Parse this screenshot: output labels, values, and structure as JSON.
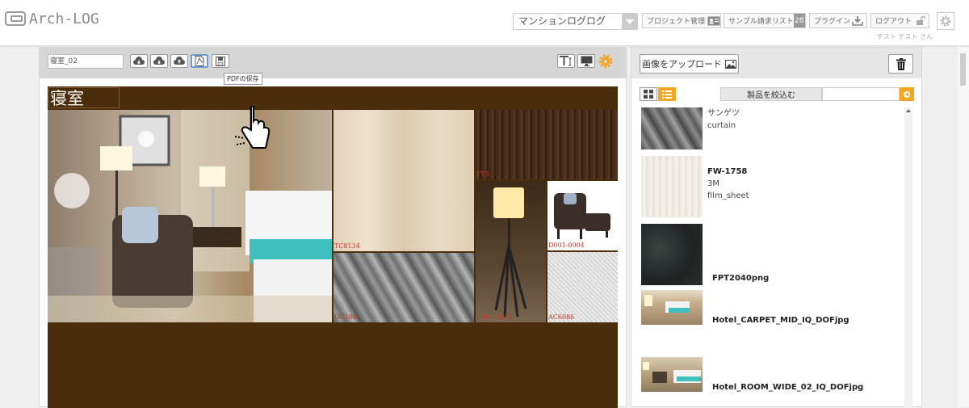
{
  "app": {
    "logo_text": "Arch-LOG"
  },
  "header": {
    "project_select": {
      "value": "マンションログログ"
    },
    "buttons": {
      "project_manage": "プロジェクト管理",
      "sample_list": "サンプル請求リスト",
      "sample_count": "28",
      "plugin": "プラグイン",
      "logout": "ログアウト"
    },
    "user_name": "テスト テスト さん"
  },
  "editor": {
    "board_name": "寝室_02",
    "tooltip": "PDFの保存",
    "board_title": "寝室",
    "tiles": [
      {
        "label": "TC8134"
      },
      {
        "label": "FT3"
      },
      {
        "label": "D001-0004"
      },
      {
        "label": "DC588"
      },
      {
        "label": "D001-0022"
      },
      {
        "label": "AC6086"
      }
    ]
  },
  "panel": {
    "upload_label": "画像をアップロード",
    "filter_label": "製品を絞込む",
    "filter_value": "",
    "items": [
      {
        "lines": [
          "サンゲツ",
          "curtain"
        ],
        "title": ""
      },
      {
        "title": "FW-1758",
        "lines": [
          "3M",
          "film_sheet"
        ]
      },
      {
        "title": "FPT2040png",
        "lines": []
      },
      {
        "title": "Hotel_CARPET_MID_IQ_DOFjpg",
        "lines": []
      },
      {
        "title": "Hotel_ROOM_WIDE_02_IQ_DOFjpg",
        "lines": []
      }
    ]
  },
  "colors": {
    "accent": "#f5a623",
    "canvas_bg": "#4a2d0a",
    "tile_label": "#c0392b"
  }
}
